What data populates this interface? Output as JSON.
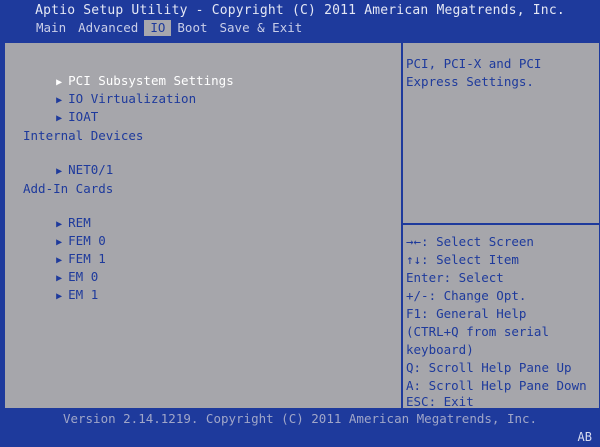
{
  "header": {
    "title": "Aptio Setup Utility - Copyright (C) 2011 American Megatrends, Inc.",
    "menu": [
      "Main",
      "Advanced",
      "IO",
      "Boot",
      "Save & Exit"
    ],
    "active_menu": "IO"
  },
  "left_pane": {
    "items_top": [
      {
        "label": "PCI Subsystem Settings",
        "selected": true
      },
      {
        "label": "IO Virtualization",
        "selected": false
      },
      {
        "label": "IOAT",
        "selected": false
      }
    ],
    "internal_devices_heading": "Internal Devices",
    "internal_devices": [
      {
        "label": "NET0/1"
      }
    ],
    "addin_cards_heading": "Add-In Cards",
    "addin_cards": [
      {
        "label": "REM"
      },
      {
        "label": "FEM 0"
      },
      {
        "label": "FEM 1"
      },
      {
        "label": "EM 0"
      },
      {
        "label": "EM 1"
      }
    ],
    "arrow_icon": "triangle-right-icon"
  },
  "right_pane": {
    "help_text": "PCI, PCI-X and PCI\nExpress Settings.",
    "keys": [
      "→←: Select Screen",
      "↑↓: Select Item",
      "Enter: Select",
      "+/-: Change Opt.",
      "F1: General Help",
      "(CTRL+Q from serial",
      "keyboard)",
      "Q: Scroll Help Pane Up",
      "A: Scroll Help Pane Down",
      "ESC: Exit"
    ]
  },
  "footer": {
    "version": "Version 2.14.1219. Copyright (C) 2011 American Megatrends, Inc.",
    "indicator": "AB"
  },
  "colors": {
    "background": "#1e3a9c",
    "panel": "#a6a6ab",
    "text": "#1e3a9c",
    "selected_text": "#ffffff"
  }
}
